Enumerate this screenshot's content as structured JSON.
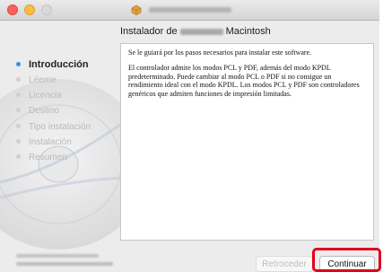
{
  "window": {
    "title_icon": "package-installer-icon"
  },
  "heading": {
    "prefix": "Instalador de",
    "suffix": "Macintosh"
  },
  "sidebar": {
    "steps": [
      {
        "label": "Introducción",
        "state": "active"
      },
      {
        "label": "Léeme",
        "state": "inactive"
      },
      {
        "label": "Licencia",
        "state": "inactive"
      },
      {
        "label": "Destino",
        "state": "inactive"
      },
      {
        "label": "Tipo instalación",
        "state": "inactive"
      },
      {
        "label": "Instalación",
        "state": "inactive"
      },
      {
        "label": "Resumen",
        "state": "inactive"
      }
    ]
  },
  "content": {
    "paragraph1": "Se le guiará por los pasos necesarios para instalar este software.",
    "paragraph2": "El controlador admite los modos PCL y PDF, además del modo KPDL predeterminado. Puede cambiar al modo PCL o PDF si no consigue un rendimiento ideal con el modo KPDL. Los modos PCL y PDF son controladores genéricos que admiten funciones de impresión limitadas."
  },
  "buttons": {
    "back_label": "Retroceder",
    "continue_label": "Continuar"
  },
  "colors": {
    "accent_bullet": "#3f8edb",
    "highlight_border": "#e0001b"
  }
}
